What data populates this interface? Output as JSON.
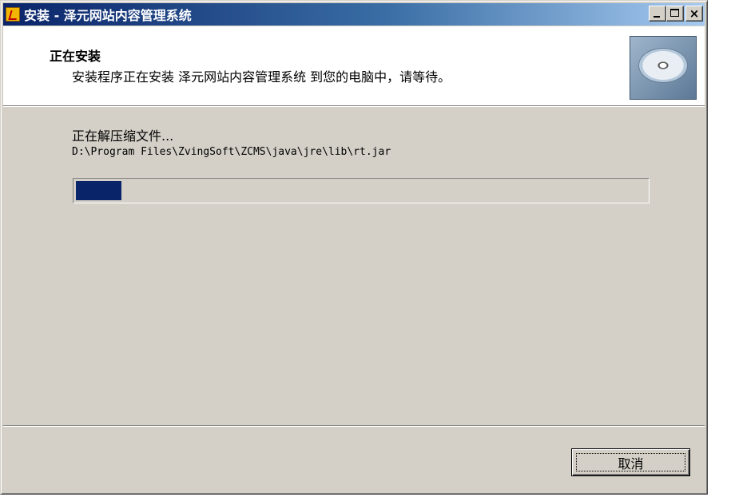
{
  "window": {
    "title": "安装 - 泽元网站内容管理系统",
    "icon": "zvingsoft-app-icon",
    "controls": {
      "minimize": "minimize-icon",
      "maximize": "maximize-icon",
      "close_label": "×"
    }
  },
  "header": {
    "title": "正在安装",
    "description": "安装程序正在安装 泽元网站内容管理系统 到您的电脑中，请等待。",
    "image": "cd-disc-icon"
  },
  "progress": {
    "status": "正在解压缩文件...",
    "current_file": "D:\\Program Files\\ZvingSoft\\ZCMS\\java\\jre\\lib\\rt.jar",
    "percent": 8
  },
  "footer": {
    "cancel_label": "取消"
  },
  "colors": {
    "titlebar_start": "#0a246a",
    "titlebar_end": "#a6caf0",
    "progress_fill": "#0a246a",
    "dialog_face": "#d4d0c8"
  }
}
